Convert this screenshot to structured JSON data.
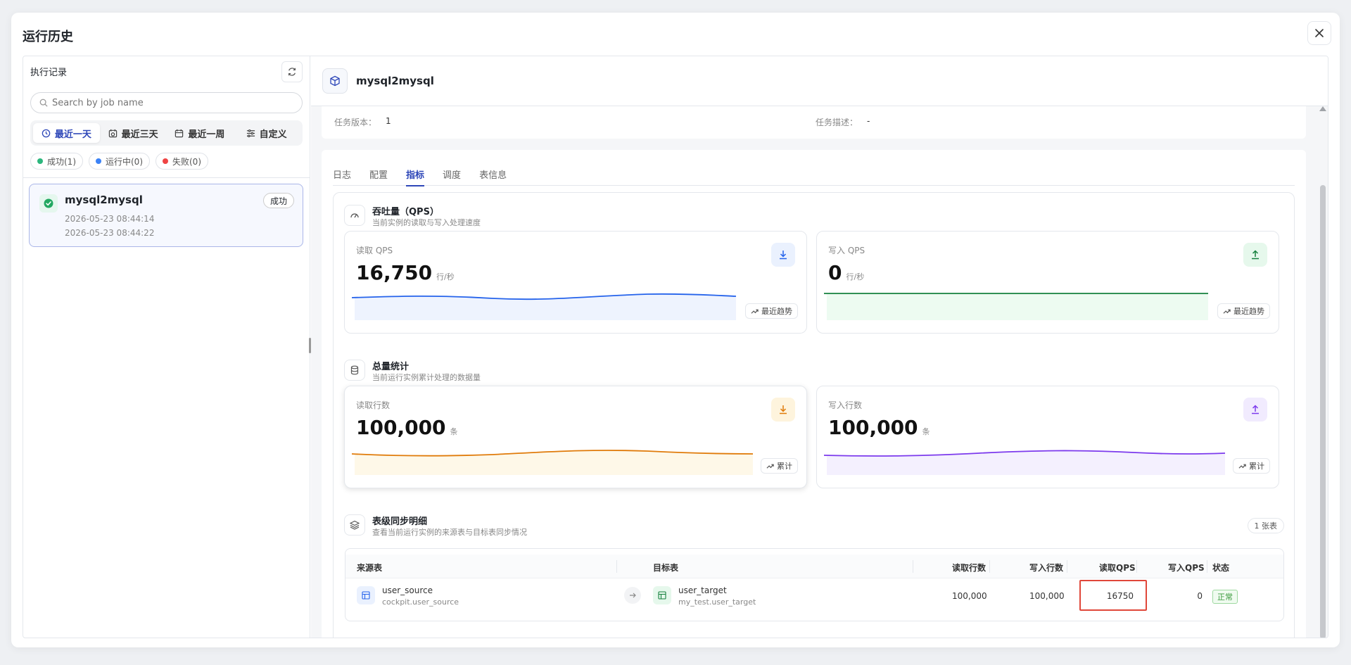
{
  "modal": {
    "title": "运行历史"
  },
  "sidebar": {
    "title": "执行记录",
    "search_placeholder": "Search by job name",
    "ranges": [
      {
        "label": "最近一天",
        "icon": "clock-icon",
        "active": true
      },
      {
        "label": "最近三天",
        "icon": "calendar-clock-icon",
        "active": false
      },
      {
        "label": "最近一周",
        "icon": "calendar-icon",
        "active": false
      },
      {
        "label": "自定义",
        "icon": "sliders-icon",
        "active": false
      }
    ],
    "status_filters": [
      {
        "label": "成功(1)",
        "color": "#2cb67d"
      },
      {
        "label": "运行中(0)",
        "color": "#3b82f6"
      },
      {
        "label": "失败(0)",
        "color": "#ef4444"
      }
    ],
    "records": [
      {
        "name": "mysql2mysql",
        "start": "2026-05-23 08:44:14",
        "end": "2026-05-23 08:44:22",
        "status": "成功"
      }
    ]
  },
  "job": {
    "name": "mysql2mysql",
    "version_label": "任务版本：",
    "version": "1",
    "desc_label": "任务描述：",
    "desc": "-"
  },
  "tabs": [
    "日志",
    "配置",
    "指标",
    "调度",
    "表信息"
  ],
  "active_tab": "指标",
  "throughput": {
    "title": "吞吐量（QPS）",
    "subtitle": "当前实例的读取与写入处理速度",
    "read": {
      "label": "读取 QPS",
      "value": "16,750",
      "unit": "行/秒",
      "trend": "最近趋势",
      "color": "#2563eb",
      "fill": "#eef3fe",
      "icon_bg": "#eaf1fe"
    },
    "write": {
      "label": "写入 QPS",
      "value": "0",
      "unit": "行/秒",
      "trend": "最近趋势",
      "color": "#15803d",
      "fill": "#edfbf1",
      "icon_bg": "#e6f8ec"
    }
  },
  "totals": {
    "title": "总量统计",
    "subtitle": "当前运行实例累计处理的数据量",
    "read": {
      "label": "读取行数",
      "value": "100,000",
      "unit": "条",
      "trend": "累计",
      "color": "#e07b0a",
      "fill": "#fef8e8",
      "icon_bg": "#fef4dd"
    },
    "write": {
      "label": "写入行数",
      "value": "100,000",
      "unit": "条",
      "trend": "累计",
      "color": "#7c3aed",
      "fill": "#f4f0fe",
      "icon_bg": "#f1ebfe"
    }
  },
  "table_detail": {
    "title": "表级同步明细",
    "subtitle": "查看当前运行实例的来源表与目标表同步情况",
    "count": "1 张表",
    "headers": {
      "source": "来源表",
      "target": "目标表",
      "read_rows": "读取行数",
      "write_rows": "写入行数",
      "read_qps": "读取QPS",
      "write_qps": "写入QPS",
      "status": "状态"
    },
    "rows": [
      {
        "source": "user_source",
        "source_full": "cockpit.user_source",
        "target": "user_target",
        "target_full": "my_test.user_target",
        "read_rows": "100,000",
        "write_rows": "100,000",
        "read_qps": "16750",
        "write_qps": "0",
        "status": "正常"
      }
    ]
  }
}
